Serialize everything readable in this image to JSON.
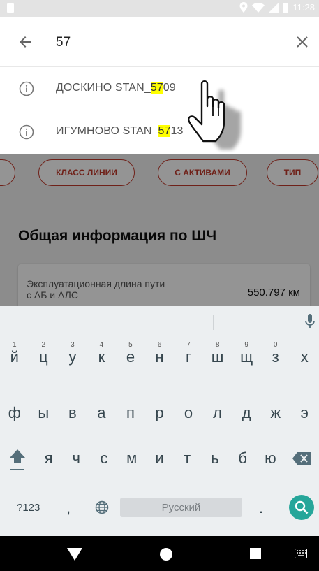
{
  "status_bar": {
    "time": "11:28"
  },
  "search": {
    "query": "57"
  },
  "suggestions": [
    {
      "prefix": "ДОСКИНО STAN_",
      "match": "57",
      "suffix": "09"
    },
    {
      "prefix": "ИГУМНОВО STAN_",
      "match": "57",
      "suffix": "13"
    }
  ],
  "filters": {
    "chips": [
      "КЛАСС ЛИНИИ",
      "С АКТИВАМИ",
      "ТИП"
    ]
  },
  "section": {
    "title": "Общая информация по ШЧ",
    "card_label": "Эксплуатационная длина пути с АБ и АЛС",
    "card_value": "550.797 км"
  },
  "keyboard": {
    "row1": [
      {
        "num": "1",
        "key": "й"
      },
      {
        "num": "2",
        "key": "ц"
      },
      {
        "num": "3",
        "key": "у"
      },
      {
        "num": "4",
        "key": "к"
      },
      {
        "num": "5",
        "key": "е"
      },
      {
        "num": "6",
        "key": "н"
      },
      {
        "num": "7",
        "key": "г"
      },
      {
        "num": "8",
        "key": "ш"
      },
      {
        "num": "9",
        "key": "щ"
      },
      {
        "num": "0",
        "key": "з"
      },
      {
        "num": "",
        "key": "х"
      }
    ],
    "row2": [
      "ф",
      "ы",
      "в",
      "а",
      "п",
      "р",
      "о",
      "л",
      "д",
      "ж",
      "э"
    ],
    "row3": [
      "я",
      "ч",
      "с",
      "м",
      "и",
      "т",
      "ь",
      "б",
      "ю"
    ],
    "symbols_label": "?123",
    "comma": ",",
    "space_label": "Русский",
    "period": "."
  },
  "colors": {
    "accent": "#c0392b",
    "highlight": "#ffff00",
    "go_button": "#26a69a"
  }
}
